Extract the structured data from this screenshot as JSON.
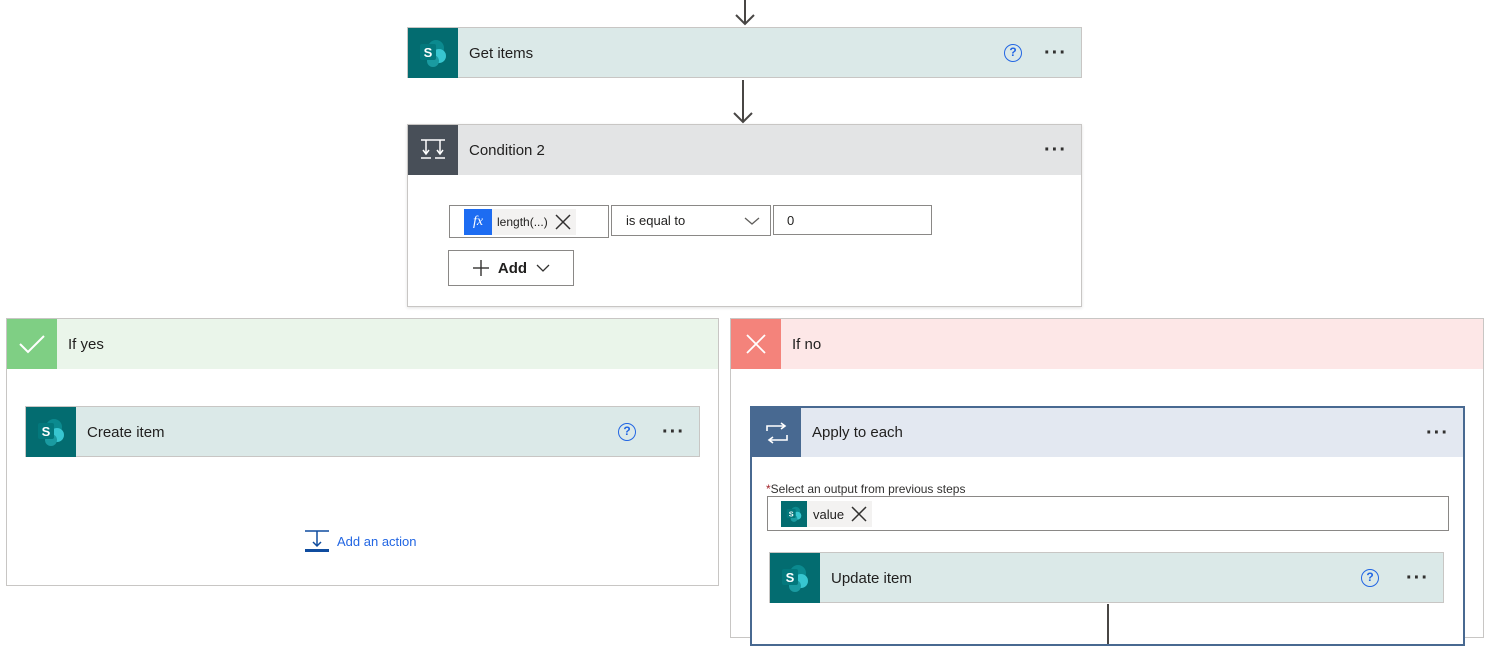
{
  "get_items": {
    "title": "Get items",
    "help": "?",
    "more": "···"
  },
  "condition": {
    "title": "Condition 2",
    "more": "···",
    "expr_token": {
      "icon_label": "fx",
      "label": "length(...)"
    },
    "operator": "is equal to",
    "value": "0",
    "add_label": "Add"
  },
  "if_yes": {
    "title": "If yes",
    "create_item": {
      "title": "Create item",
      "help": "?",
      "more": "···"
    },
    "add_action": "Add an action"
  },
  "if_no": {
    "title": "If no",
    "apply_each": {
      "title": "Apply to each",
      "more": "···",
      "required_mark": "*",
      "field_label": "Select an output from previous steps",
      "token_label": "value",
      "update_item": {
        "title": "Update item",
        "help": "?",
        "more": "···"
      }
    }
  },
  "colors": {
    "sharepoint": "#036c70",
    "action_header": "#dbe9e8",
    "condition_header": "#e3e4e5",
    "condition_icon": "#484f58",
    "yes_header": "#eaf5ea",
    "yes_icon": "#7fcf84",
    "no_header": "#fde7e7",
    "no_icon": "#f4837b",
    "loop_header": "#e3e8f1",
    "loop_icon": "#486991",
    "link": "#2266e3"
  }
}
